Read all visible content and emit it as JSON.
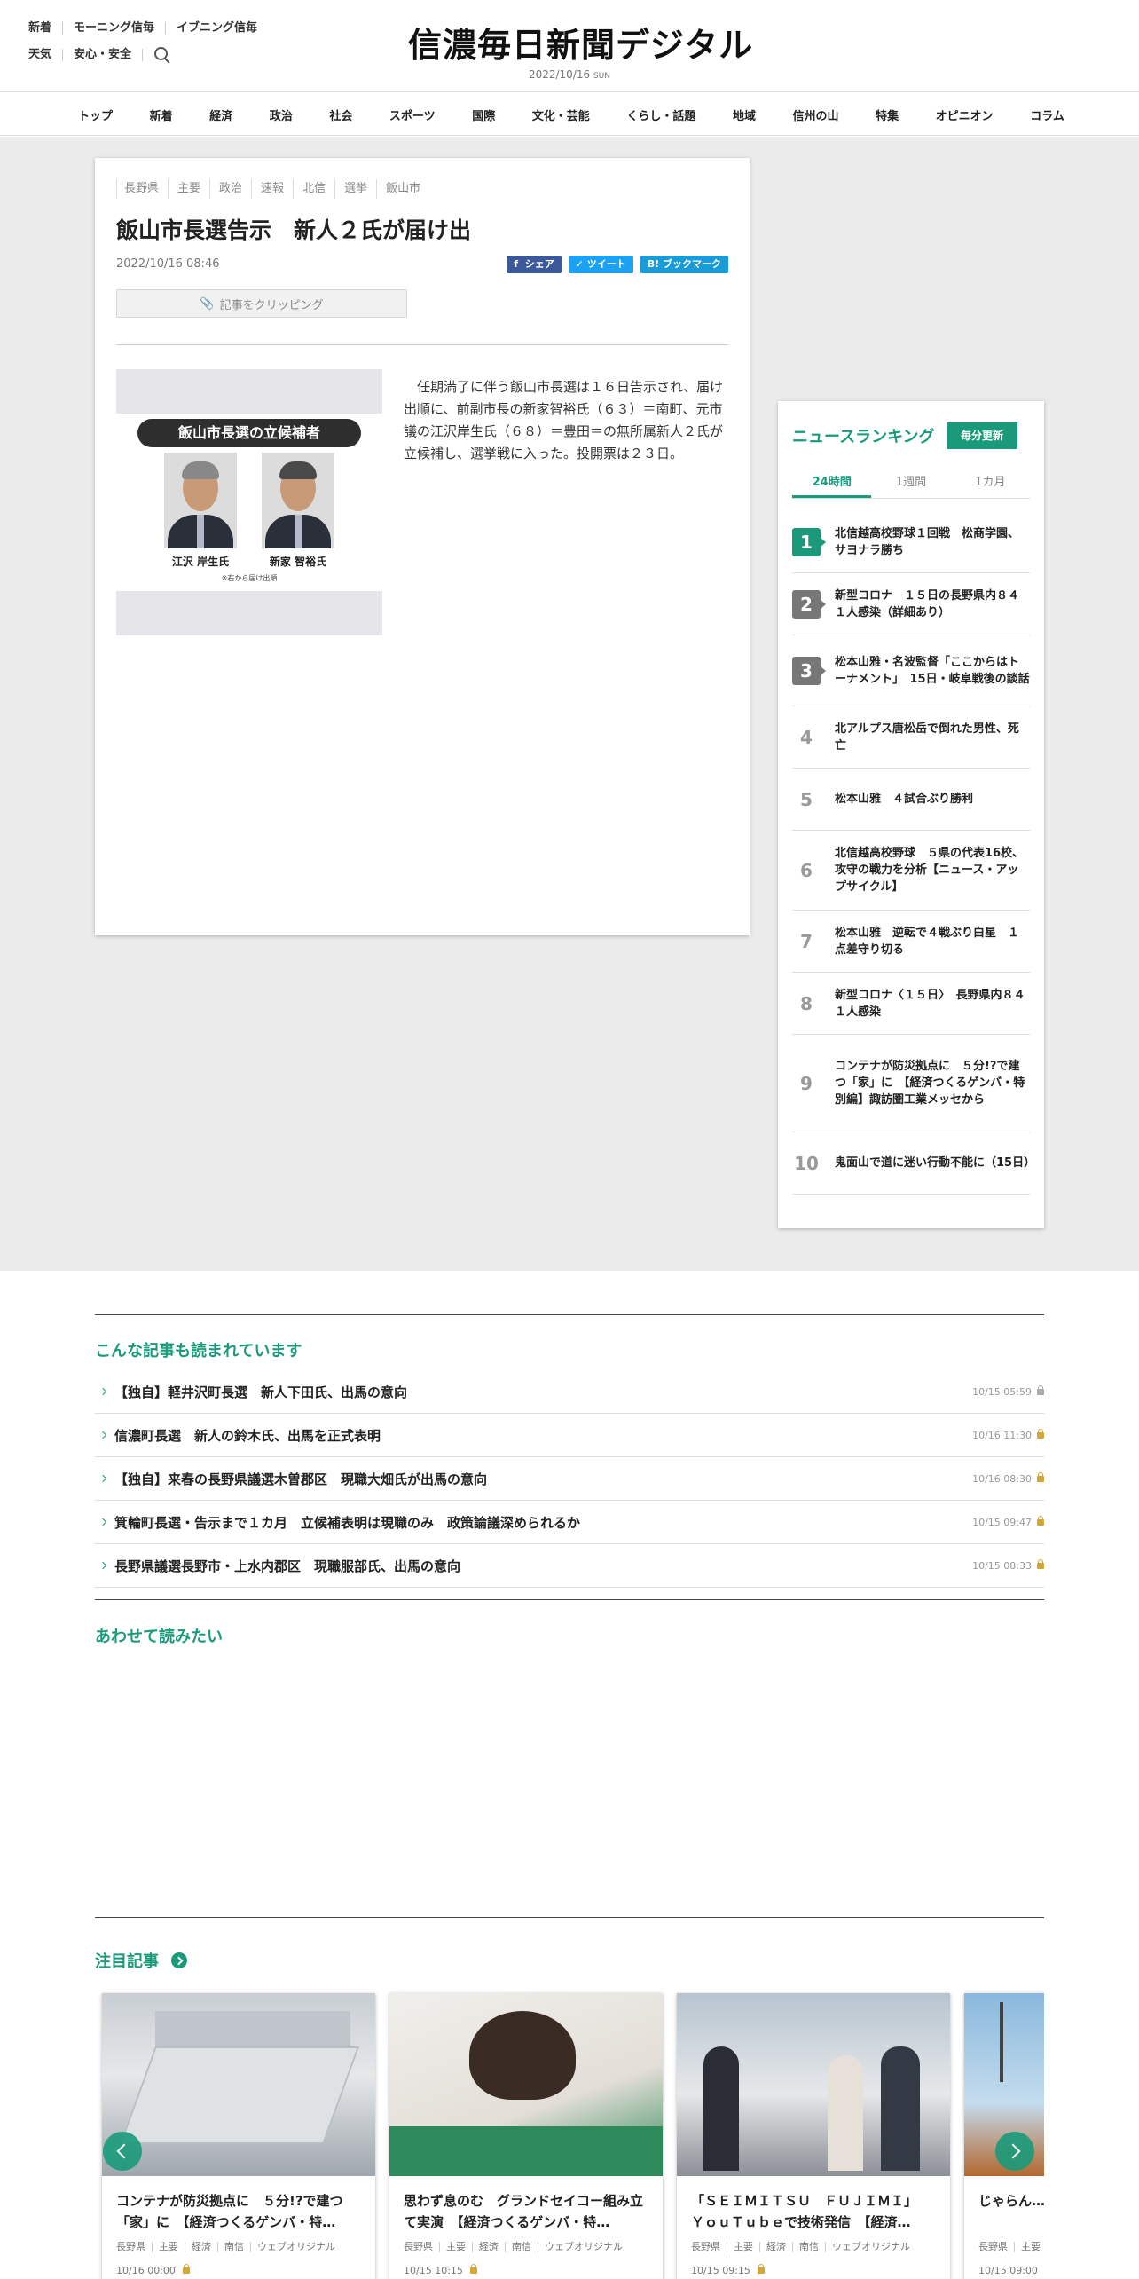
{
  "header": {
    "links_row1": [
      "新着",
      "モーニング信毎",
      "イブニング信毎"
    ],
    "links_row2": [
      "天気",
      "安心・安全"
    ],
    "logo": "信濃毎日新聞デジタル",
    "date": "2022/10/16",
    "day": "SUN"
  },
  "nav": [
    "トップ",
    "新着",
    "経済",
    "政治",
    "社会",
    "スポーツ",
    "国際",
    "文化・芸能",
    "くらし・話題",
    "地域",
    "信州の山",
    "特集",
    "オピニオン",
    "コラム"
  ],
  "article": {
    "tags": [
      "長野県",
      "主要",
      "政治",
      "速報",
      "北信",
      "選挙",
      "飯山市"
    ],
    "title": "飯山市長選告示　新人２氏が届け出",
    "date": "2022/10/16 08:46",
    "share": {
      "facebook": "シェア",
      "twitter": "ツイート",
      "hatena": "B! ブックマーク"
    },
    "clip_label": "記事をクリッピング",
    "photo": {
      "caption": "飯山市長選の立候補者",
      "candidates": [
        "江沢 岸生氏",
        "新家 智裕氏"
      ],
      "note": "※右から届け出順"
    },
    "body": "任期満了に伴う飯山市長選は１６日告示され、届け出順に、前副市長の新家智裕氏（６３）＝南町、元市議の江沢岸生氏（６８）＝豊田＝の無所属新人２氏が立候補し、選挙戦に入った。投開票は２３日。"
  },
  "ranking": {
    "title": "ニュースランキング",
    "badge": "毎分更新",
    "tabs": [
      "24時間",
      "1週間",
      "1カ月"
    ],
    "active_tab": "24時間",
    "items": [
      {
        "rank": "1",
        "text": "北信越高校野球１回戦　松商学園、サヨナラ勝ち"
      },
      {
        "rank": "2",
        "text": "新型コロナ　１５日の長野県内８４１人感染（詳細あり）"
      },
      {
        "rank": "3",
        "text": "松本山雅・名波監督「ここからはトーナメント」　15日・岐阜戦後の談話"
      },
      {
        "rank": "4",
        "text": "北アルプス唐松岳で倒れた男性、死亡"
      },
      {
        "rank": "5",
        "text": "松本山雅　４試合ぶり勝利"
      },
      {
        "rank": "6",
        "text": "北信越高校野球　５県の代表16校、攻守の戦力を分析【ニュース・アップサイクル】"
      },
      {
        "rank": "7",
        "text": "松本山雅　逆転で４戦ぶり白星　１点差守り切る"
      },
      {
        "rank": "8",
        "text": "新型コロナ〈１５日〉　長野県内８４１人感染"
      },
      {
        "rank": "9",
        "text": "コンテナが防災拠点に　５分!?で建つ「家」に　【経済つくるゲンバ・特別編】諏訪圏工業メッセから"
      },
      {
        "rank": "10",
        "text": "鬼面山で道に迷い行動不能に（15日）"
      }
    ]
  },
  "related": {
    "title": "こんな記事も読まれています",
    "items": [
      {
        "title": "【独自】軽井沢町長選　新人下田氏、出馬の意向",
        "date": "10/15 05:59",
        "lock": "grey"
      },
      {
        "title": "信濃町長選　新人の鈴木氏、出馬を正式表明",
        "date": "10/16 11:30",
        "lock": "gold"
      },
      {
        "title": "【独自】来春の長野県議選木曽郡区　現職大畑氏が出馬の意向",
        "date": "10/16 08:30",
        "lock": "gold"
      },
      {
        "title": "箕輪町長選・告示まで１カ月　立候補表明は現職のみ　政策論議深められるか",
        "date": "10/15 09:47",
        "lock": "gold"
      },
      {
        "title": "長野県議選長野市・上水内郡区　現職服部氏、出馬の意向",
        "date": "10/15 08:33",
        "lock": "gold"
      }
    ]
  },
  "also_read": {
    "title": "あわせて読みたい"
  },
  "featured": {
    "title": "注目記事",
    "cards": [
      {
        "title": "コンテナが防災拠点に　５分!?で建つ「家」に　【経済つくるゲンバ・特…",
        "tags": [
          "長野県",
          "主要",
          "経済",
          "南信",
          "ウェブオリジナル"
        ],
        "date": "10/16 00:00"
      },
      {
        "title": "思わず息のむ　グランドセイコー組み立て実演　【経済つくるゲンバ・特…",
        "tags": [
          "長野県",
          "主要",
          "経済",
          "南信",
          "ウェブオリジナル"
        ],
        "date": "10/15 10:15"
      },
      {
        "title": "「ＳＥＩＭＩＴＳＵ　ＦＵＪＩＭＩ」　ＹｏｕＴｕｂｅで技術発信　【経済…",
        "tags": [
          "長野県",
          "主要",
          "経済",
          "南信",
          "ウェブオリジナル"
        ],
        "date": "10/15 09:15"
      },
      {
        "title": "じゃらん… 長野県から…",
        "tags": [
          "長野県",
          "主要"
        ],
        "date": "10/15 09:00"
      }
    ]
  },
  "colors": {
    "accent": "#1a9a7a",
    "background_band": "#ebebeb"
  }
}
